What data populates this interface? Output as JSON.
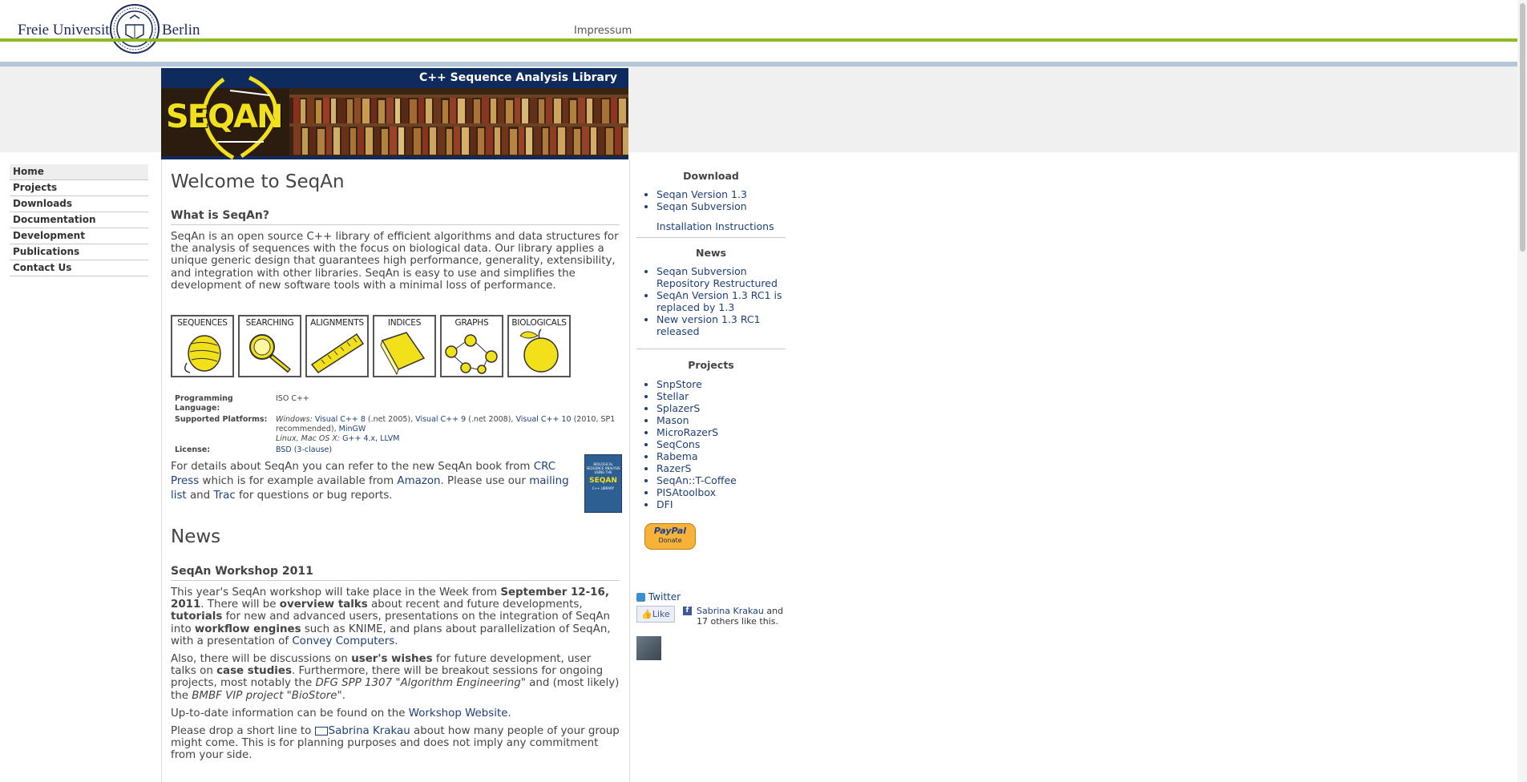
{
  "header": {
    "fu_left": "Freie Universität",
    "fu_right": "Berlin",
    "impressum": "Impressum"
  },
  "banner": {
    "title": "C++ Sequence Analysis Library",
    "logo_text": "SEQAN"
  },
  "nav": {
    "items": [
      "Home",
      "Projects",
      "Downloads",
      "Documentation",
      "Development",
      "Publications",
      "Contact Us"
    ]
  },
  "main": {
    "title": "Welcome to SeqAn",
    "what_heading": "What is SeqAn?",
    "intro": "SeqAn is an open source C++ library of efficient algorithms and data structures for the analysis of sequences with the focus on biological data. Our library applies a unique generic design that guarantees high performance, generality, extensibility, and integration with other libraries. SeqAn is easy to use and simplifies the development of new software tools with a minimal loss of performance.",
    "categories": [
      "SEQUENCES",
      "SEARCHING",
      "ALIGNMENTS",
      "INDICES",
      "GRAPHS",
      "BIOLOGICALS"
    ],
    "facts": {
      "lang_key": "Programming Language:",
      "lang_val": "ISO C++",
      "platforms_key": "Supported Platforms:",
      "win_label": "Windows:",
      "vc8": "Visual C++ 8",
      "vc8_note": "(.net 2005),",
      "vc9": "Visual C++ 9",
      "vc9_note": "(.net 2008),",
      "vc10": "Visual C++ 10",
      "vc10_note": "(2010, SP1 recommended),",
      "mingw": "MinGW",
      "linux_label": "Linux, Mac OS X:",
      "gcc": "G++ 4.x",
      "llvm": "LLVM",
      "license_key": "License:",
      "license_val": "BSD (3-clause)"
    },
    "book": {
      "t1": "For details about SeqAn you can refer to the new SeqAn book from",
      "crc": "CRC Press",
      "t2": "which is for example available from",
      "amazon": "Amazon",
      "t3": ". Please use our",
      "mailing": "mailing list",
      "t4": "and",
      "trac": "Trac",
      "t5": "for questions or bug reports.",
      "cover_title": "BIOLOGICAL SEQUENCE ANALYSIS USING THE",
      "cover_logo": "SEQAN",
      "cover_sub": "C++ LIBRARY"
    },
    "news_heading": "News",
    "workshop": {
      "heading": "SeqAn Workshop 2011",
      "p1a": "This year's SeqAn workshop will take place in the Week from",
      "p1b": "September 12-16, 2011",
      "p1c": ". There will be",
      "p1d": "overview talks",
      "p1e": "about recent and future developments,",
      "p1f": "tutorials",
      "p1g": "for new and advanced users, presentations on the integration of SeqAn into",
      "p1h": "workflow engines",
      "p1i": "such as KNIME, and plans about parallelization of SeqAn, with a presentation of",
      "p1j": "Convey Computers",
      "p1k": ".",
      "p2a": "Also, there will be discussions on",
      "p2b": "user's wishes",
      "p2c": "for future development, user talks on",
      "p2d": "case studies",
      "p2e": ". Furthermore, there will be breakout sessions for ongoing projects, most notably the",
      "p2f": "DFG SPP 1307 \"Algorithm Engineering\"",
      "p2g": "and (most likely) the",
      "p2h": "BMBF VIP project \"BioStore\"",
      "p2i": ".",
      "p3a": "Up-to-date information can be found on the",
      "p3b": "Workshop Website",
      "p3c": ".",
      "p4a": "Please drop a short line to",
      "p4b": "Sabrina Krakau",
      "p4c": "about how many people of your group might come. This is for planning purposes and does not imply any commitment from your side."
    }
  },
  "sidebar": {
    "download_heading": "Download",
    "downloads": [
      "Seqan Version 1.3",
      "Seqan Subversion"
    ],
    "install": "Installation Instructions",
    "news_heading": "News",
    "news": [
      "Seqan Subversion Repository Restructured",
      "SeqAn Version 1.3 RC1 is replaced by 1.3",
      "New version 1.3 RC1 released"
    ],
    "projects_heading": "Projects",
    "projects": [
      "SnpStore",
      "Stellar",
      "SplazerS",
      "Mason",
      "MicroRazerS",
      "SeqCons",
      "Rabema",
      "RazerS",
      "SeqAn::T-Coffee",
      "PISAtoolbox",
      "DFI"
    ],
    "paypal_brand": "PayPal",
    "paypal_action": "Donate",
    "twitter": "Twitter",
    "like": "Like",
    "fb_name": "Sabrina Krakau",
    "fb_and": "and",
    "fb_others": "17 others like this."
  }
}
